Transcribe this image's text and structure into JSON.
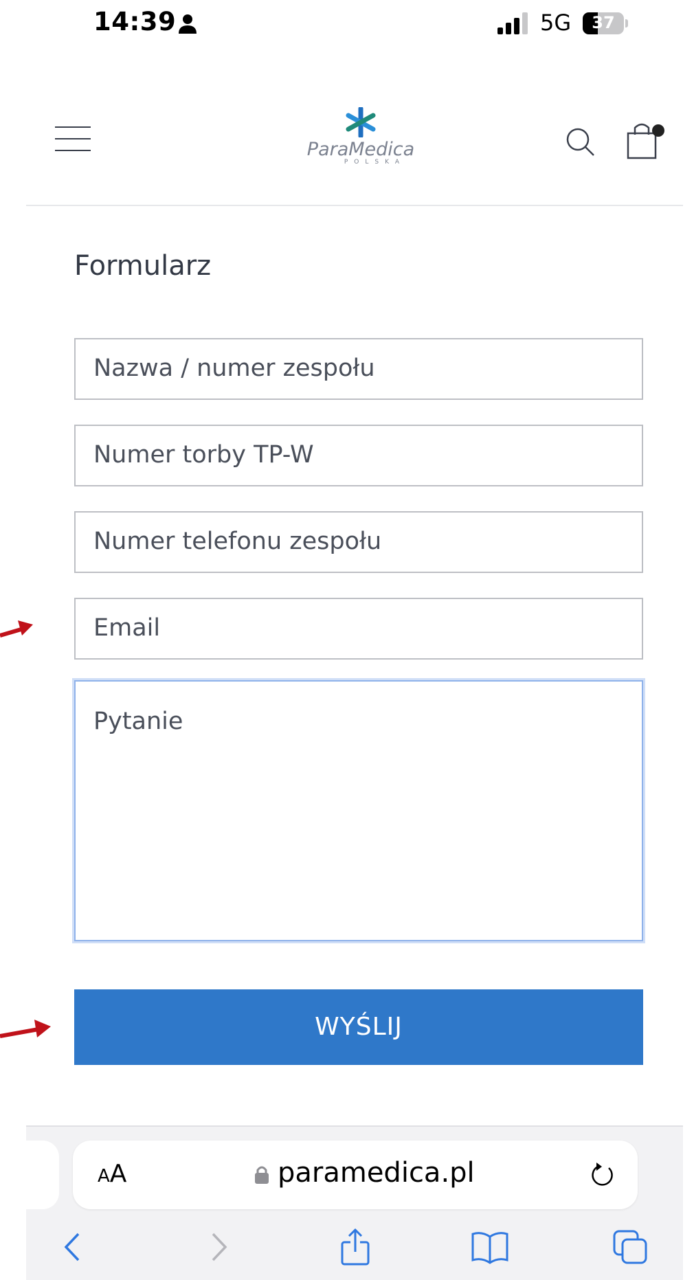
{
  "status_bar": {
    "time": "14:39",
    "network": "5G",
    "battery_level": "37",
    "battery_fraction": 0.37
  },
  "header": {
    "logo_name": "ParaMedica",
    "logo_sub": "POLSKA",
    "icons": [
      "menu-icon",
      "logo-mark",
      "search-icon",
      "cart-icon"
    ]
  },
  "form": {
    "title": "Formularz",
    "fields": {
      "team_name": "Nazwa / numer zespołu",
      "bag_number": "Numer torby TP-W",
      "team_phone": "Numer telefonu zespołu",
      "email": "Email",
      "question": "Pytanie"
    },
    "submit_label": "WYŚLIJ"
  },
  "colors": {
    "accent": "#2f78c9",
    "annotation_arrow": "#c0121a",
    "focus_border": "#8fb2ea"
  },
  "browser": {
    "text_size_small": "A",
    "text_size_large": "A",
    "url": "paramedica.pl",
    "toolbar_icons": [
      "back-icon",
      "forward-icon",
      "share-icon",
      "bookmarks-icon",
      "tabs-icon"
    ]
  }
}
